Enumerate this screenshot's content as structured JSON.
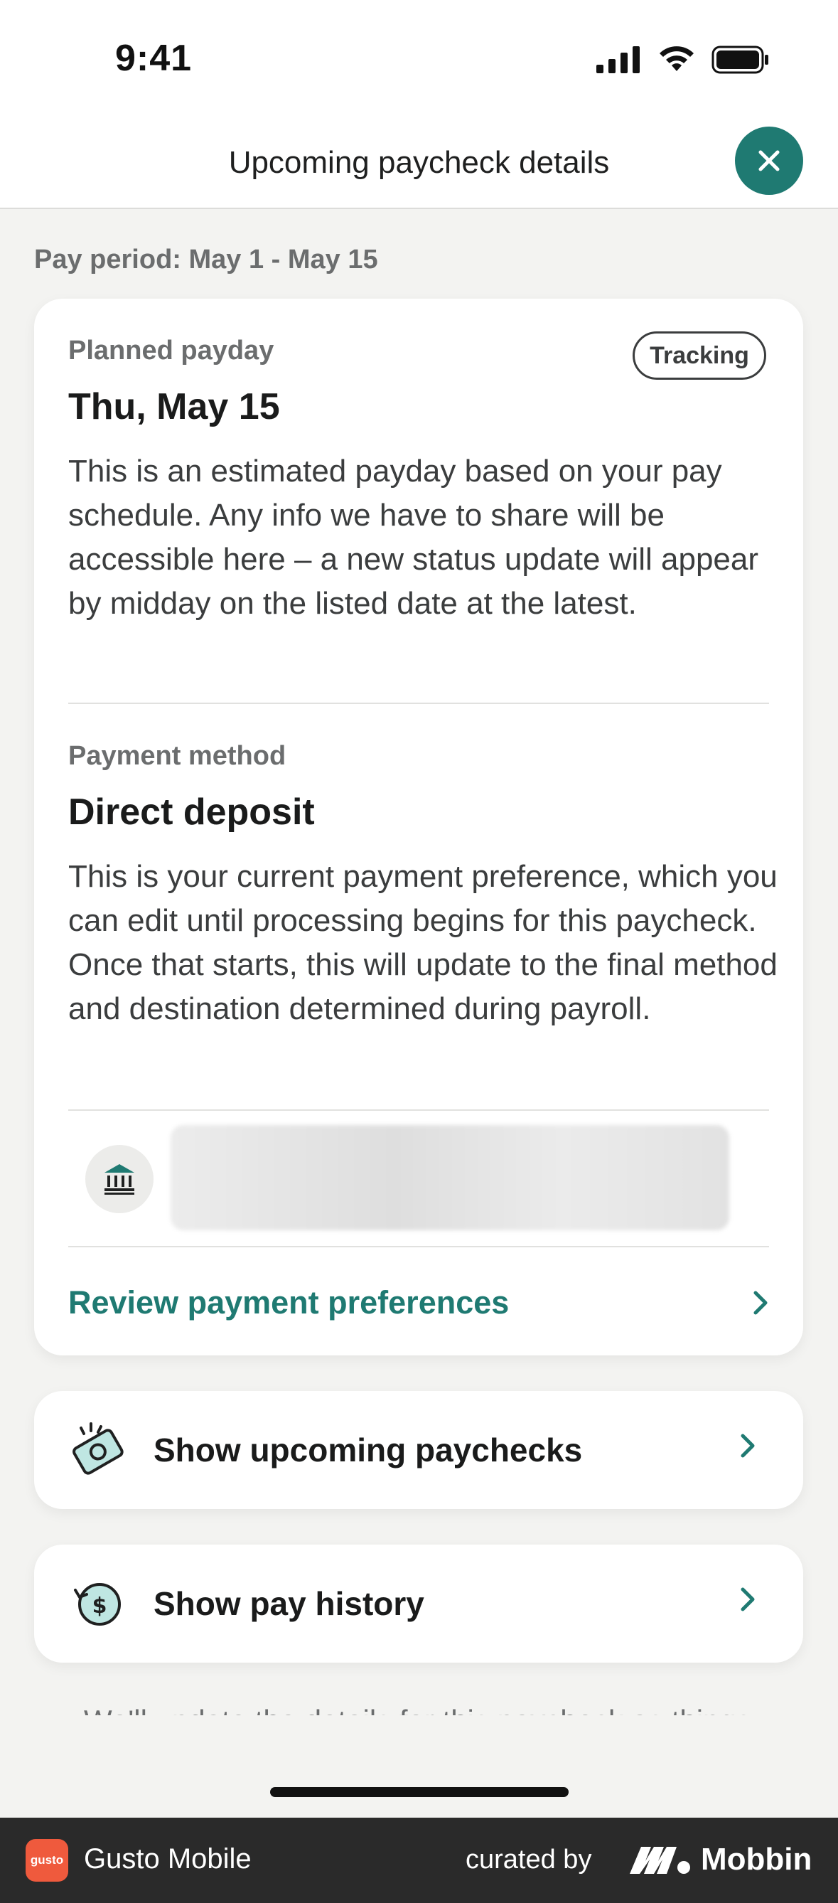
{
  "status_bar": {
    "time": "9:41"
  },
  "header": {
    "title": "Upcoming paycheck details"
  },
  "pay_period": "Pay period: May 1 - May 15",
  "payday_section": {
    "label": "Planned payday",
    "badge": "Tracking",
    "date": "Thu, May 15",
    "description": "This is an estimated payday based on your pay schedule. Any info we have to share will be accessible here – a new status update will appear by midday on the listed date at the latest."
  },
  "payment_section": {
    "label": "Payment method",
    "method": "Direct deposit",
    "description": "This is your current payment preference, which you can edit until processing begins for this paycheck. Once that starts, this will update to the final method and destination determined during payroll."
  },
  "review_link": "Review payment preferences",
  "rows": {
    "upcoming": "Show upcoming paychecks",
    "history": "Show pay history"
  },
  "peek_text": "We'll update the details for this paycheck as things move until",
  "footer": {
    "app_logo_text": "gusto",
    "app_name": "Gusto Mobile",
    "curated_by": "curated by",
    "brand": "Mobbin"
  },
  "colors": {
    "accent": "#1f7a72",
    "background": "#f3f3f1",
    "card": "#ffffff"
  }
}
